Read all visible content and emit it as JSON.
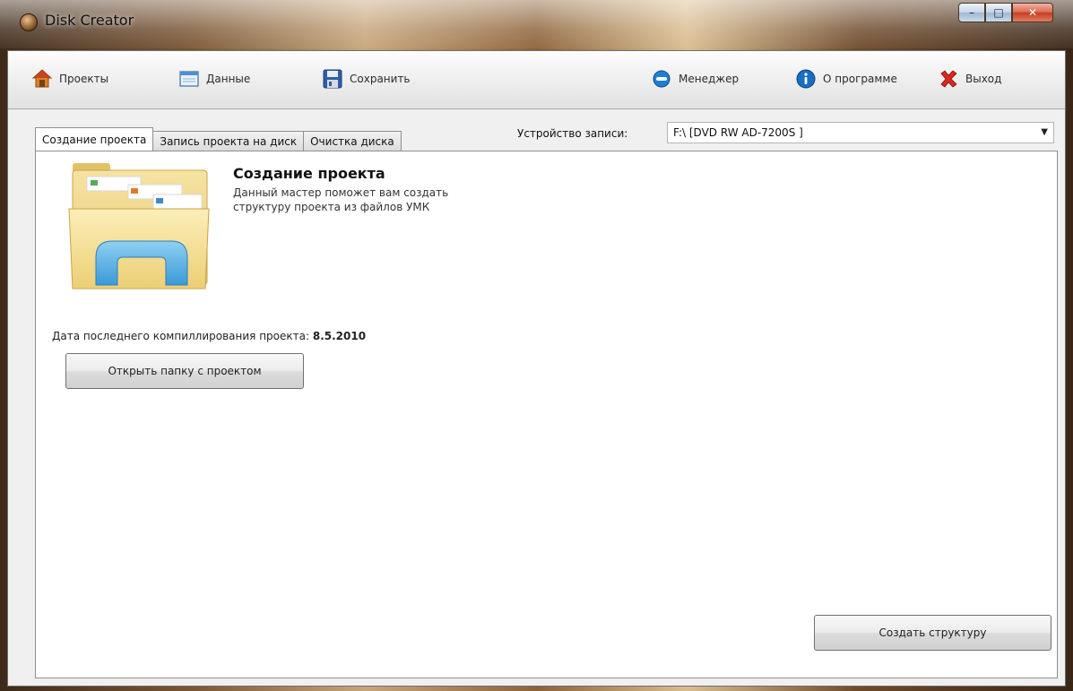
{
  "window": {
    "title": "Disk Creator",
    "controls": {
      "minimize": "–",
      "maximize": "□",
      "close": "✕"
    }
  },
  "toolbar": {
    "items": [
      {
        "label": "Проекты",
        "icon": "house-icon"
      },
      {
        "label": "Данные",
        "icon": "window-icon"
      },
      {
        "label": "Сохранить",
        "icon": "floppy-disk-icon"
      },
      {
        "label": "Менеджер",
        "icon": "manager-icon"
      },
      {
        "label": "О программе",
        "icon": "info-icon"
      },
      {
        "label": "Выход",
        "icon": "exit-x-icon"
      }
    ]
  },
  "tabs": [
    {
      "label": "Создание проекта",
      "active": true
    },
    {
      "label": "Запись проекта на диск",
      "active": false
    },
    {
      "label": "Очистка диска",
      "active": false
    }
  ],
  "device": {
    "label": "Устройство записи:",
    "value": "F:\\ [DVD RW AD-7200S ]"
  },
  "wizard": {
    "title": "Создание проекта",
    "description_line1": "Данный мастер поможет вам создать",
    "description_line2": "структуру проекта из файлов УМК",
    "last_compile_label": "Дата последнего компиллирования проекта:",
    "last_compile_value": "8.5.2010",
    "open_folder_button": "Открыть папку с проектом",
    "create_structure_button": "Создать структуру"
  },
  "colors": {
    "accent_blue": "#1b6fc2",
    "exit_red": "#d62a1e",
    "panel_bg": "#ffffff",
    "window_bg": "#f0f0f0"
  }
}
